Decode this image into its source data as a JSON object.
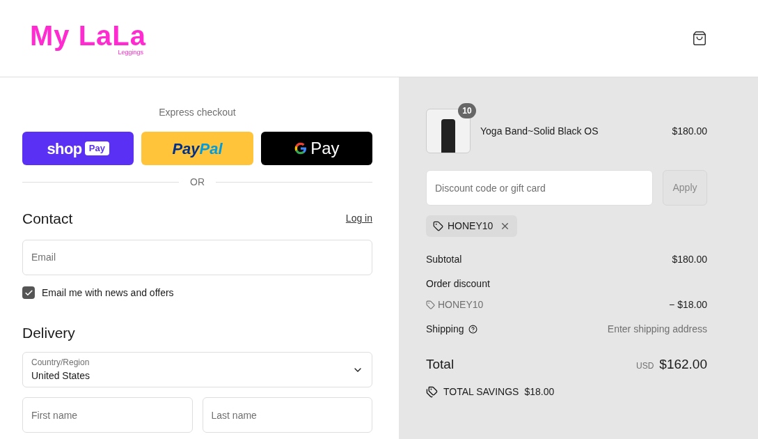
{
  "header": {
    "logo": {
      "name": "My LaLa",
      "tagline": "Leggings"
    }
  },
  "express_checkout": {
    "title": "Express checkout",
    "buttons": [
      {
        "kind": "shoppay",
        "label": "shop",
        "badge": "Pay"
      },
      {
        "kind": "paypal",
        "label": "Pay",
        "label_2": "Pal"
      },
      {
        "kind": "gpay",
        "label": "Pay"
      }
    ],
    "divider": "OR"
  },
  "contact": {
    "heading": "Contact",
    "link": "Log in",
    "email": {
      "placeholder": "Email"
    },
    "newsletter": {
      "label": "Email me with news and offers",
      "checked": true
    }
  },
  "delivery": {
    "heading": "Delivery",
    "country": {
      "label": "Country/Region",
      "value": "United States"
    },
    "first_name": {
      "placeholder": "First name"
    },
    "last_name": {
      "placeholder": "Last name"
    }
  },
  "summary": {
    "items": [
      {
        "name": "Yoga Band~Solid Black OS",
        "quantity": "10",
        "price": "$180.00"
      }
    ],
    "discount": {
      "placeholder": "Discount code or gift card",
      "button": "Apply",
      "applied": "HONEY10"
    },
    "subtotal": {
      "label": "Subtotal",
      "value": "$180.00"
    },
    "order_discount": {
      "label": "Order discount",
      "code": "HONEY10",
      "value": "− $18.00"
    },
    "shipping": {
      "label": "Shipping",
      "value": "Enter shipping address"
    },
    "total": {
      "label": "Total",
      "currency": "USD",
      "value": "$162.00"
    },
    "savings": {
      "label": "TOTAL SAVINGS",
      "value": "$18.00"
    }
  }
}
